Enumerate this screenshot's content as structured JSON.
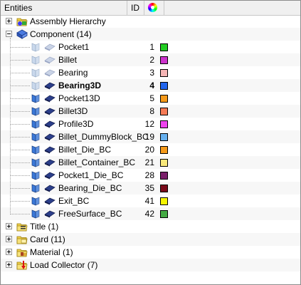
{
  "header": {
    "entities_label": "Entities",
    "id_label": "ID",
    "color_icon": "color-wheel-icon"
  },
  "tree": {
    "assembly": {
      "label": "Assembly Hierarchy"
    },
    "component": {
      "label": "Component (14)",
      "items": [
        {
          "label": "Pocket1",
          "id": "1",
          "color": "#22cc22",
          "bold": false,
          "visible": false
        },
        {
          "label": "Billet",
          "id": "2",
          "color": "#cc33cc",
          "bold": false,
          "visible": false
        },
        {
          "label": "Bearing",
          "id": "3",
          "color": "#f5b5b5",
          "bold": false,
          "visible": false
        },
        {
          "label": "Bearing3D",
          "id": "4",
          "color": "#2266ee",
          "bold": true,
          "visible": false
        },
        {
          "label": "Pocket13D",
          "id": "5",
          "color": "#f59a1a",
          "bold": false,
          "visible": true
        },
        {
          "label": "Billet3D",
          "id": "8",
          "color": "#f57a55",
          "bold": false,
          "visible": true
        },
        {
          "label": "Profile3D",
          "id": "12",
          "color": "#ee44ee",
          "bold": false,
          "visible": true
        },
        {
          "label": "Billet_DummyBlock_BC",
          "id": "19",
          "color": "#66b0ee",
          "bold": false,
          "visible": true
        },
        {
          "label": "Billet_Die_BC",
          "id": "20",
          "color": "#f59a1a",
          "bold": false,
          "visible": true
        },
        {
          "label": "Billet_Container_BC",
          "id": "21",
          "color": "#f8e87a",
          "bold": false,
          "visible": true
        },
        {
          "label": "Pocket1_Die_BC",
          "id": "28",
          "color": "#7a1f6a",
          "bold": false,
          "visible": true
        },
        {
          "label": "Bearing_Die_BC",
          "id": "35",
          "color": "#7a0a1a",
          "bold": false,
          "visible": true
        },
        {
          "label": "Exit_BC",
          "id": "41",
          "color": "#f5f500",
          "bold": false,
          "visible": true
        },
        {
          "label": "FreeSurface_BC",
          "id": "42",
          "color": "#44aa44",
          "bold": false,
          "visible": true
        }
      ]
    },
    "title": {
      "label": "Title (1)"
    },
    "card": {
      "label": "Card (11)"
    },
    "material": {
      "label": "Material (1)"
    },
    "load_collector": {
      "label": "Load Collector (7)"
    }
  }
}
